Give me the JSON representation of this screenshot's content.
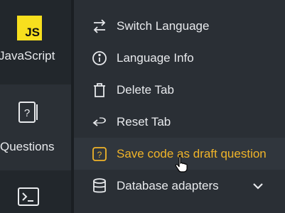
{
  "sidebar": {
    "items": [
      {
        "label": "JavaScript",
        "icon": "js-logo-icon"
      },
      {
        "label": "Questions",
        "icon": "question-card-icon"
      },
      {
        "label": "",
        "icon": "terminal-icon"
      }
    ],
    "js_badge_text": "JS",
    "js_badge_color": "#f7df1e"
  },
  "menu": {
    "items": [
      {
        "label": "Switch Language",
        "icon": "switch-arrows-icon"
      },
      {
        "label": "Language Info",
        "icon": "info-icon"
      },
      {
        "label": "Delete Tab",
        "icon": "trash-icon"
      },
      {
        "label": "Reset Tab",
        "icon": "undo-arrow-icon"
      },
      {
        "label": "Save code as draft question",
        "icon": "draft-question-icon",
        "highlighted": true
      },
      {
        "label": "Database adapters",
        "icon": "database-icon",
        "expandable": true
      }
    ],
    "highlight_color": "#f0b429"
  }
}
